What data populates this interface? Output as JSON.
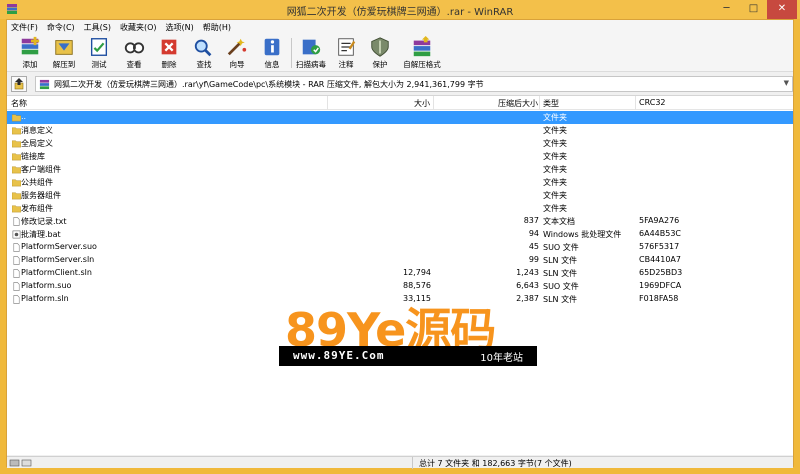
{
  "window": {
    "title": "网狐二次开发（仿爱玩棋牌三网通）.rar - WinRAR",
    "min": "─",
    "max": "□",
    "close": "✕"
  },
  "menu": [
    "文件(F)",
    "命令(C)",
    "工具(S)",
    "收藏夹(O)",
    "选项(N)",
    "帮助(H)"
  ],
  "toolbar": [
    {
      "label": "添加",
      "icon": "add-icon"
    },
    {
      "label": "解压到",
      "icon": "extract-to-icon"
    },
    {
      "label": "测试",
      "icon": "test-icon"
    },
    {
      "label": "查看",
      "icon": "view-icon"
    },
    {
      "label": "删除",
      "icon": "delete-icon"
    },
    {
      "label": "查找",
      "icon": "find-icon"
    },
    {
      "label": "向导",
      "icon": "wizard-icon"
    },
    {
      "label": "信息",
      "icon": "info-icon"
    },
    {
      "label": "扫描病毒",
      "icon": "virus-scan-icon"
    },
    {
      "label": "注释",
      "icon": "comment-icon"
    },
    {
      "label": "保护",
      "icon": "protect-icon"
    },
    {
      "label": "自解压格式",
      "icon": "sfx-icon"
    }
  ],
  "address": {
    "path": "网狐二次开发（仿爱玩棋牌三网通）.rar\\yf\\GameCode\\pc\\系统模块 - RAR 压缩文件, 解包大小为 2,941,361,799 字节"
  },
  "columns": {
    "name": "名称",
    "size": "大小",
    "packed": "压缩后大小",
    "type": "类型",
    "crc": "CRC32"
  },
  "files": [
    {
      "name": "..",
      "size": "",
      "packed": "",
      "type": "文件夹",
      "crc": "",
      "kind": "parent",
      "selected": true
    },
    {
      "name": "消息定义",
      "size": "",
      "packed": "",
      "type": "文件夹",
      "crc": "",
      "kind": "folder"
    },
    {
      "name": "全局定义",
      "size": "",
      "packed": "",
      "type": "文件夹",
      "crc": "",
      "kind": "folder"
    },
    {
      "name": "链接库",
      "size": "",
      "packed": "",
      "type": "文件夹",
      "crc": "",
      "kind": "folder"
    },
    {
      "name": "客户端组件",
      "size": "",
      "packed": "",
      "type": "文件夹",
      "crc": "",
      "kind": "folder"
    },
    {
      "name": "公共组件",
      "size": "",
      "packed": "",
      "type": "文件夹",
      "crc": "",
      "kind": "folder"
    },
    {
      "name": "服务器组件",
      "size": "",
      "packed": "",
      "type": "文件夹",
      "crc": "",
      "kind": "folder"
    },
    {
      "name": "发布组件",
      "size": "",
      "packed": "",
      "type": "文件夹",
      "crc": "",
      "kind": "folder"
    },
    {
      "name": "修改记录.txt",
      "size": "",
      "packed": "837",
      "type": "文本文档",
      "crc": "5FA9A276",
      "kind": "file"
    },
    {
      "name": "批清理.bat",
      "size": "",
      "packed": "94",
      "type": "Windows 批处理文件",
      "crc": "6A44B53C",
      "kind": "bat"
    },
    {
      "name": "PlatformServer.suo",
      "size": "",
      "packed": "45",
      "type": "SUO 文件",
      "crc": "576F5317",
      "kind": "file"
    },
    {
      "name": "PlatformServer.sln",
      "size": "",
      "packed": "99",
      "type": "SLN 文件",
      "crc": "CB4410A7",
      "kind": "file"
    },
    {
      "name": "PlatformClient.sln",
      "size": "12,794",
      "packed": "1,243",
      "type": "SLN 文件",
      "crc": "65D25BD3",
      "kind": "file"
    },
    {
      "name": "Platform.suo",
      "size": "88,576",
      "packed": "6,643",
      "type": "SUO 文件",
      "crc": "1969DFCA",
      "kind": "file"
    },
    {
      "name": "Platform.sln",
      "size": "33,115",
      "packed": "2,387",
      "type": "SLN 文件",
      "crc": "F018FA58",
      "kind": "file"
    }
  ],
  "watermark": {
    "brand": "89Ye源码",
    "url": "www.89YE.Com",
    "slogan": "10年老站"
  },
  "status": {
    "summary": "总计 7 文件夹 和 182,663 字节(7 个文件)"
  },
  "colors": {
    "title_bar": "#f3c04a",
    "selection": "#3399ff",
    "close_button": "#c7493f",
    "watermark_orange": "#f7941d"
  }
}
